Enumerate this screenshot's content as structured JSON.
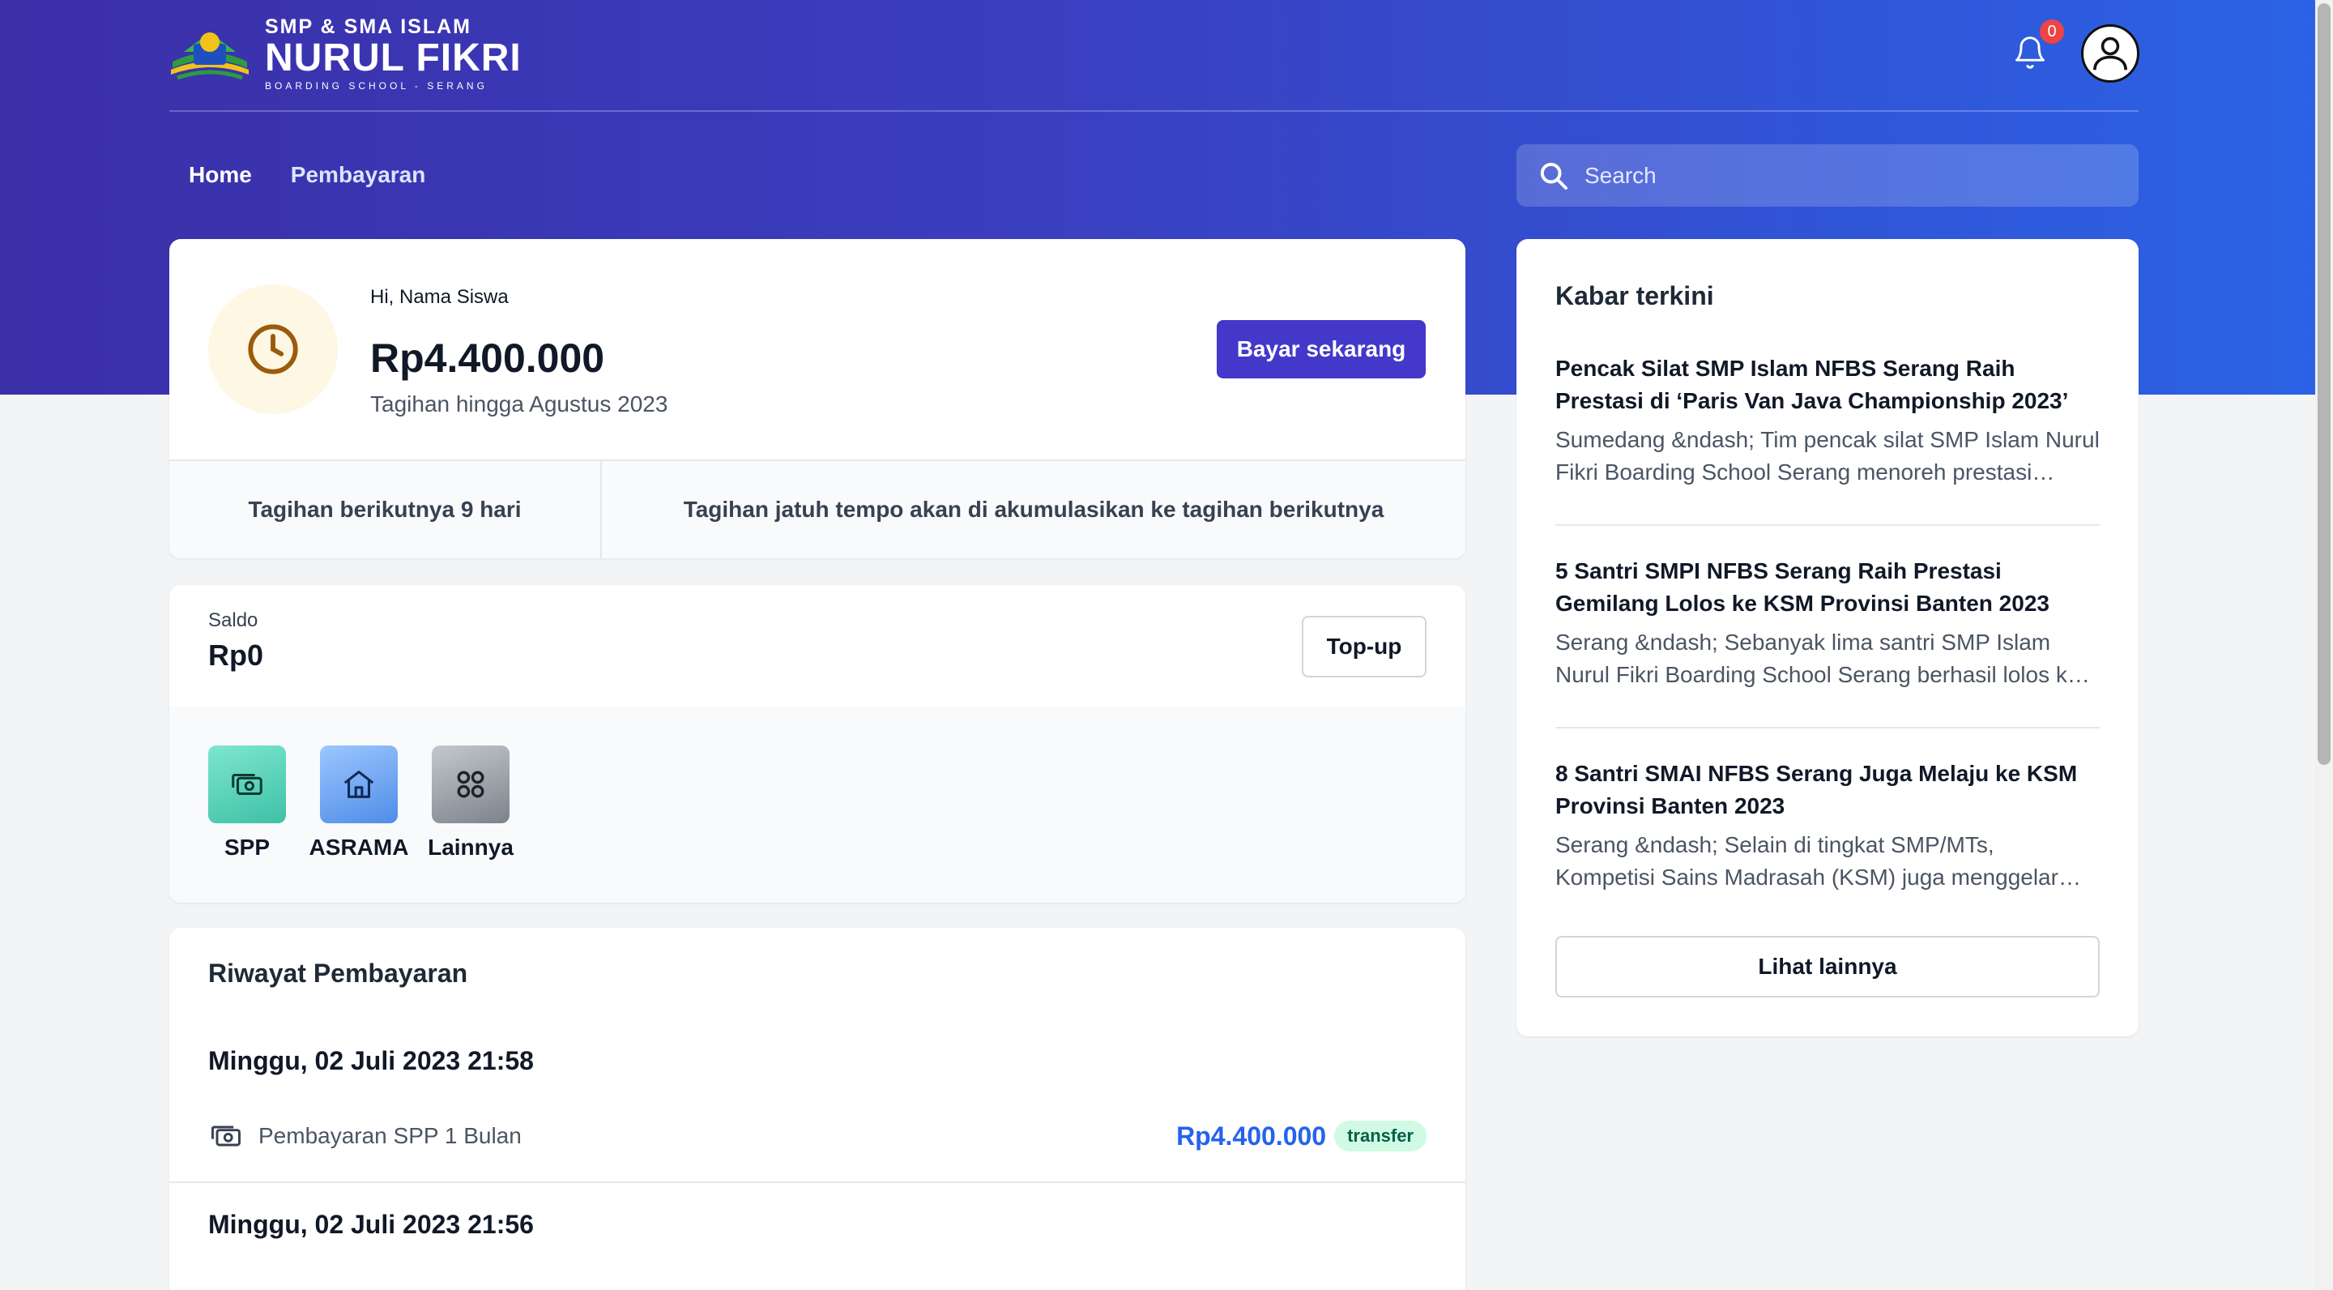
{
  "brand": {
    "line1": "SMP & SMA ISLAM",
    "line2": "NURUL FIKRI",
    "line3": "BOARDING SCHOOL - SERANG",
    "colors": {
      "header_start": "#3b2fa8",
      "header_end": "#2b63e6",
      "primary": "#4338ca"
    }
  },
  "header": {
    "notification_count": "0"
  },
  "nav": {
    "home": "Home",
    "pembayaran": "Pembayaran"
  },
  "search": {
    "placeholder": "Search"
  },
  "bill": {
    "greeting": "Hi, Nama Siswa",
    "amount": "Rp4.400.000",
    "subtitle": "Tagihan hingga Agustus 2023",
    "pay_label": "Bayar sekarang",
    "next_bill": "Tagihan berikutnya 9 hari",
    "note": "Tagihan jatuh tempo akan di akumulasikan ke tagihan berikutnya"
  },
  "saldo": {
    "label": "Saldo",
    "amount": "Rp0",
    "topup_label": "Top-up",
    "menu": [
      {
        "label": "SPP",
        "icon": "cash-icon",
        "color": "#5fd3bc"
      },
      {
        "label": "ASRAMA",
        "icon": "home-icon",
        "color": "#6aa6f0"
      },
      {
        "label": "Lainnya",
        "icon": "grid-icon",
        "color": "#9aa0a8"
      }
    ]
  },
  "history": {
    "title": "Riwayat Pembayaran",
    "entries": [
      {
        "date": "Minggu, 02 Juli 2023 21:58",
        "desc": "Pembayaran SPP 1 Bulan",
        "amount": "Rp4.400.000",
        "method": "transfer"
      },
      {
        "date": "Minggu, 02 Juli 2023 21:56"
      }
    ]
  },
  "news": {
    "title": "Kabar terkini",
    "items": [
      {
        "title": "Pencak Silat SMP Islam NFBS Serang Raih Prestasi di ‘Paris Van Java Championship 2023’",
        "excerpt": "Sumedang &ndash; Tim pencak silat SMP Islam Nurul Fikri Boarding School Serang menoreh prestasi gemilang"
      },
      {
        "title": "5 Santri SMPI NFBS Serang Raih Prestasi Gemilang Lolos ke KSM Provinsi Banten 2023",
        "excerpt": "Serang &ndash; Sebanyak lima santri SMP Islam Nurul Fikri Boarding School Serang berhasil lolos ke tingkat provinsi"
      },
      {
        "title": "8 Santri SMAI NFBS Serang Juga Melaju ke KSM Provinsi Banten 2023",
        "excerpt": "Serang &ndash; Selain di tingkat SMP/MTs, Kompetisi Sains Madrasah (KSM) juga menggelar perlombaan tingkat MA"
      }
    ],
    "more_label": "Lihat lainnya"
  }
}
